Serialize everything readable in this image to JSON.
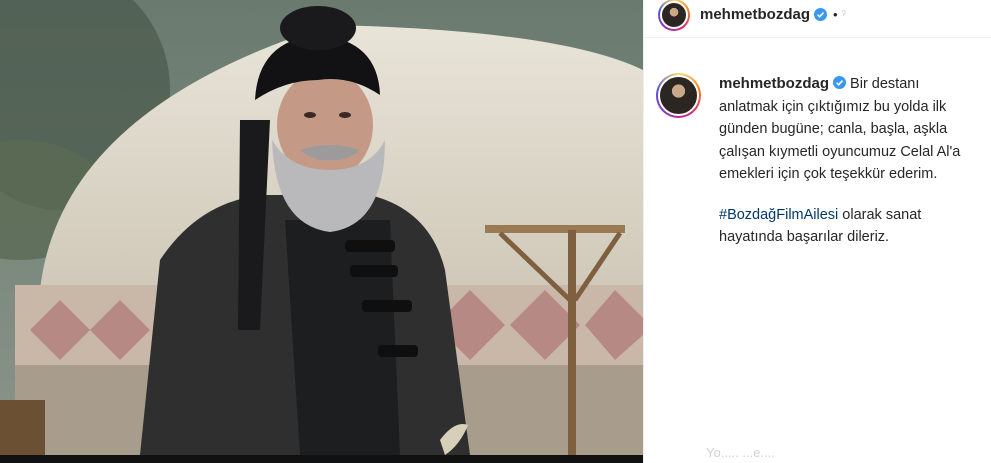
{
  "post": {
    "username": "mehmetbozdag",
    "header_dot": "•",
    "header_follow": "ˀ",
    "caption_first": "Bir destanı anlatmak için çıktığımız bu yolda ilk günden bugüne; canla, başla, aşkla çalışan kıymetli oyuncumuz Celal Al'a emekleri için çok teşekkür ederim.",
    "hashtag": "#BozdağFilmAilesi",
    "caption_second": " olarak sanat hayatında başarılar dileriz.",
    "faint_text": "Yo..... ...e...."
  },
  "colors": {
    "verified": "#3897f0",
    "hashtag": "#00376b"
  }
}
